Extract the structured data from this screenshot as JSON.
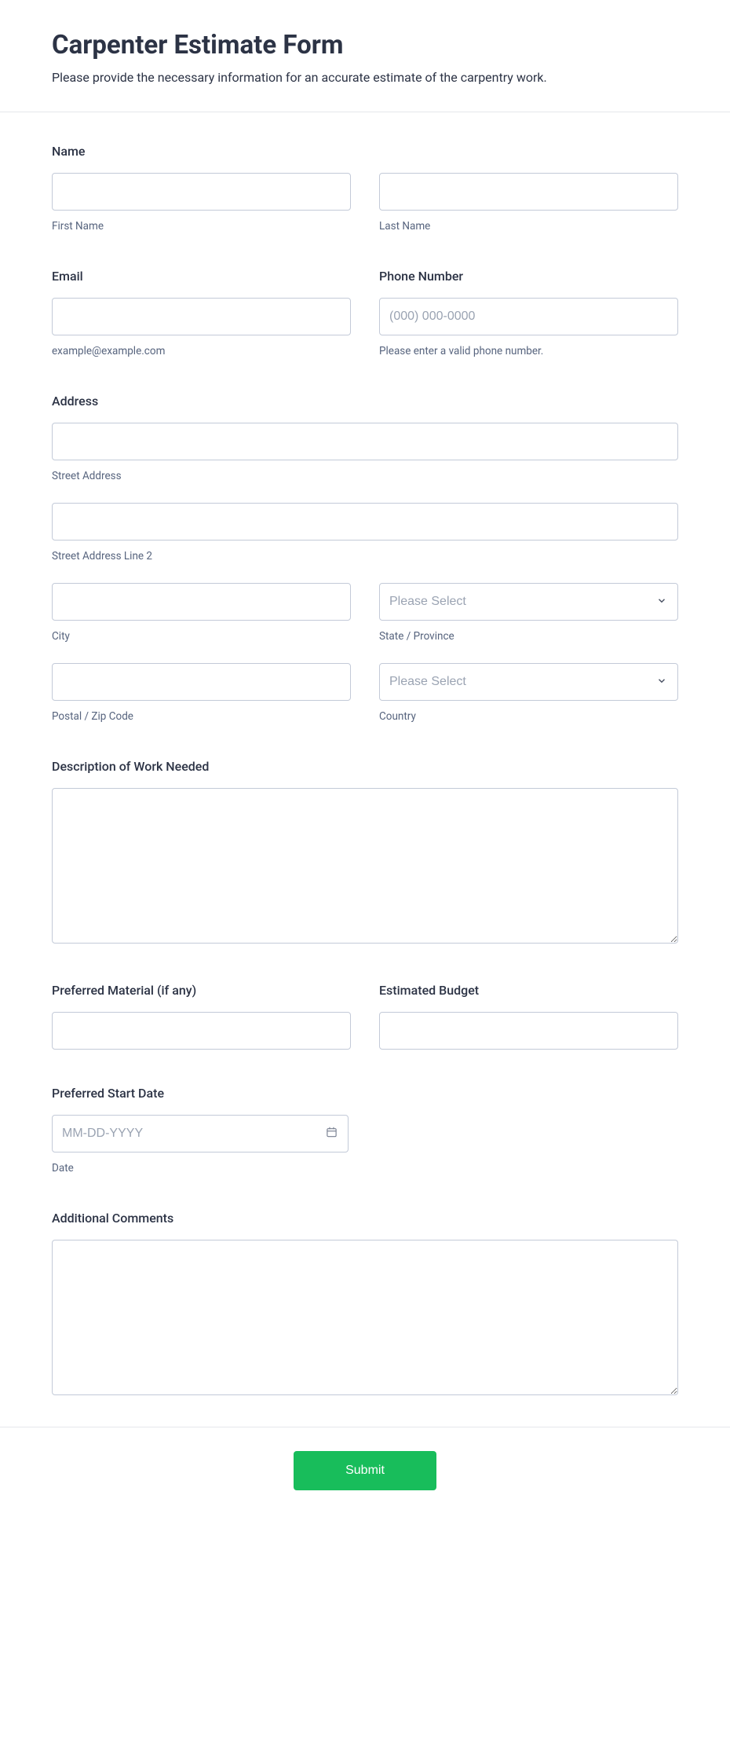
{
  "header": {
    "title": "Carpenter Estimate Form",
    "subtitle": "Please provide the necessary information for an accurate estimate of the carpentry work."
  },
  "name": {
    "label": "Name",
    "first_sublabel": "First Name",
    "last_sublabel": "Last Name"
  },
  "email": {
    "label": "Email",
    "sublabel": "example@example.com"
  },
  "phone": {
    "label": "Phone Number",
    "placeholder": "(000) 000-0000",
    "sublabel": "Please enter a valid phone number."
  },
  "address": {
    "label": "Address",
    "street_sublabel": "Street Address",
    "street2_sublabel": "Street Address Line 2",
    "city_sublabel": "City",
    "state_sublabel": "State / Province",
    "state_placeholder": "Please Select",
    "postal_sublabel": "Postal / Zip Code",
    "country_sublabel": "Country",
    "country_placeholder": "Please Select"
  },
  "description": {
    "label": "Description of Work Needed"
  },
  "material": {
    "label": "Preferred Material (if any)"
  },
  "budget": {
    "label": "Estimated Budget"
  },
  "start_date": {
    "label": "Preferred Start Date",
    "placeholder": "MM-DD-YYYY",
    "sublabel": "Date"
  },
  "comments": {
    "label": "Additional Comments"
  },
  "submit": {
    "label": "Submit"
  }
}
